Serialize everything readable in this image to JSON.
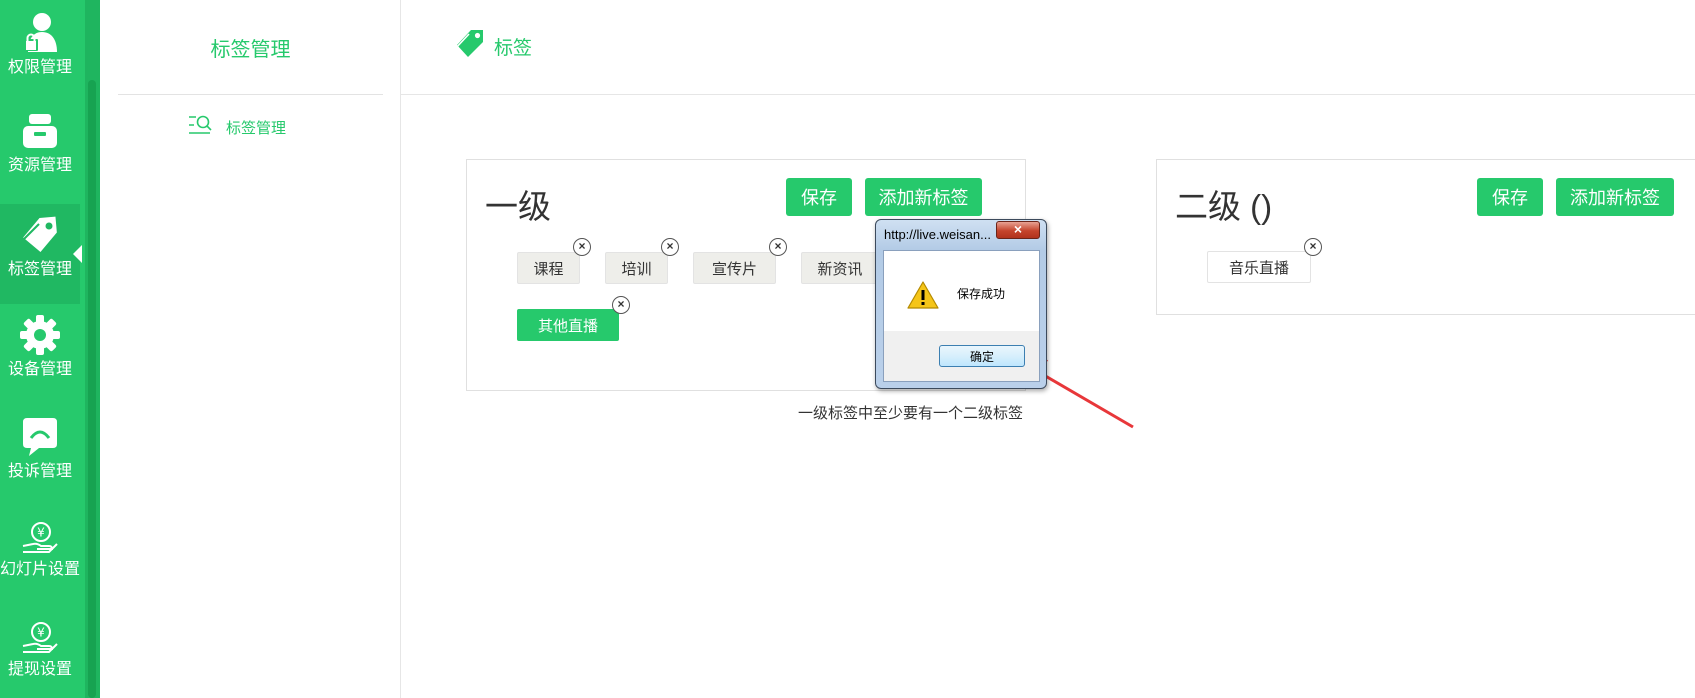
{
  "rail": {
    "items": [
      {
        "label": "权限管理",
        "icon": "user-lock-icon"
      },
      {
        "label": "资源管理",
        "icon": "inbox-icon"
      },
      {
        "label": "标签管理",
        "icon": "tag-icon",
        "active": true
      },
      {
        "label": "设备管理",
        "icon": "gear-icon"
      },
      {
        "label": "投诉管理",
        "icon": "chat-icon"
      },
      {
        "label": "幻灯片设置",
        "icon": "yen-hand-icon"
      },
      {
        "label": "提现设置",
        "icon": "yen-hand-icon"
      }
    ]
  },
  "submenu": {
    "title": "标签管理",
    "item_label": "标签管理",
    "item_icon": "list-search-icon"
  },
  "header": {
    "tag_label": "标签",
    "tag_icon": "tag-icon"
  },
  "level1": {
    "title": "一级",
    "save_label": "保存",
    "add_label": "添加新标签",
    "tags": [
      {
        "label": "课程",
        "selected": false
      },
      {
        "label": "培训",
        "selected": false
      },
      {
        "label": "宣传片",
        "selected": false
      },
      {
        "label": "新资讯",
        "selected": false
      },
      {
        "label": "其他直播",
        "selected": true
      }
    ],
    "remove_symbol": "×"
  },
  "level2": {
    "title": "二级 ()",
    "save_label": "保存",
    "add_label": "添加新标签",
    "tags": [
      {
        "label": "音乐直播"
      }
    ]
  },
  "hint": "一级标签中至少要有一个二级标签",
  "dialog": {
    "title": "http://live.weisan...",
    "close_symbol": "×",
    "message": "保存成功",
    "ok_label": "确定",
    "icon": "warning-icon"
  },
  "colors": {
    "accent": "#26c96c",
    "arrow": "#e8373a"
  }
}
